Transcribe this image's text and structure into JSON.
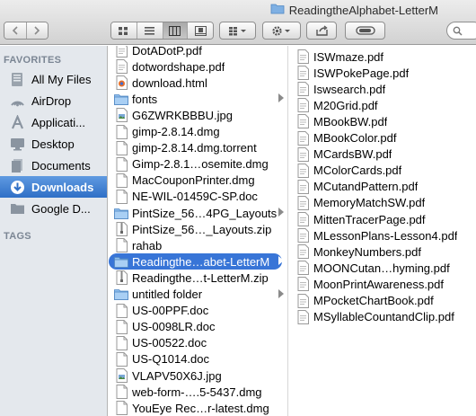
{
  "window": {
    "title": "ReadingtheAlphabet-LetterM"
  },
  "toolbar": {
    "back_icon": "chevron-left-icon",
    "forward_icon": "chevron-right-icon",
    "view_modes": [
      "icon-view-icon",
      "list-view-icon",
      "column-view-icon",
      "cover-flow-icon"
    ],
    "active_view": "column-view-icon",
    "arrange_icon": "arrange-icon",
    "action_icon": "gear-icon",
    "share_icon": "share-icon",
    "tag_icon": "tag-icon"
  },
  "sidebar": {
    "favorites_heading": "FAVORITES",
    "tags_heading": "TAGS",
    "items": [
      {
        "label": "All My Files",
        "icon": "all-files-icon"
      },
      {
        "label": "AirDrop",
        "icon": "airdrop-icon"
      },
      {
        "label": "Applicati...",
        "icon": "applications-icon"
      },
      {
        "label": "Desktop",
        "icon": "desktop-icon"
      },
      {
        "label": "Documents",
        "icon": "documents-icon"
      },
      {
        "label": "Downloads",
        "icon": "downloads-icon",
        "selected": true
      },
      {
        "label": "Google D...",
        "icon": "folder-icon"
      }
    ]
  },
  "column1": [
    {
      "label": "DotADotP.pdf",
      "icon": "pdf-icon"
    },
    {
      "label": "dotwordshape.pdf",
      "icon": "pdf-icon"
    },
    {
      "label": "download.html",
      "icon": "html-icon"
    },
    {
      "label": "fonts",
      "icon": "folder-icon",
      "folder": true
    },
    {
      "label": "G6ZWRKBBBU.jpg",
      "icon": "image-icon"
    },
    {
      "label": "gimp-2.8.14.dmg",
      "icon": "dmg-icon"
    },
    {
      "label": "gimp-2.8.14.dmg.torrent",
      "icon": "file-icon"
    },
    {
      "label": "Gimp-2.8.1…osemite.dmg",
      "icon": "dmg-icon"
    },
    {
      "label": "MacCouponPrinter.dmg",
      "icon": "dmg-icon"
    },
    {
      "label": "NE-WIL-01459C-SP.doc",
      "icon": "doc-icon"
    },
    {
      "label": "PintSize_56…4PG_Layouts",
      "icon": "folder-icon",
      "folder": true
    },
    {
      "label": "PintSize_56…_Layouts.zip",
      "icon": "zip-icon"
    },
    {
      "label": "rahab",
      "icon": "file-icon"
    },
    {
      "label": "Readingthe…abet-LetterM",
      "icon": "folder-icon",
      "folder": true,
      "selected": true
    },
    {
      "label": "Readingthe…t-LetterM.zip",
      "icon": "zip-icon"
    },
    {
      "label": "untitled folder",
      "icon": "folder-icon",
      "folder": true
    },
    {
      "label": "US-00PPF.doc",
      "icon": "doc-icon"
    },
    {
      "label": "US-0098LR.doc",
      "icon": "doc-icon"
    },
    {
      "label": "US-00522.doc",
      "icon": "doc-icon"
    },
    {
      "label": "US-Q1014.doc",
      "icon": "doc-icon"
    },
    {
      "label": "VLAPV50X6J.jpg",
      "icon": "image-icon"
    },
    {
      "label": "web-form-….5-5437.dmg",
      "icon": "dmg-icon"
    },
    {
      "label": "YouEye Rec…r-latest.dmg",
      "icon": "dmg-icon"
    }
  ],
  "column2": [
    {
      "label": "ISWmaze.pdf",
      "icon": "pdf-icon"
    },
    {
      "label": "ISWPokePage.pdf",
      "icon": "pdf-icon"
    },
    {
      "label": "Iswsearch.pdf",
      "icon": "pdf-icon"
    },
    {
      "label": "M20Grid.pdf",
      "icon": "pdf-icon"
    },
    {
      "label": "MBookBW.pdf",
      "icon": "pdf-icon"
    },
    {
      "label": "MBookColor.pdf",
      "icon": "pdf-icon"
    },
    {
      "label": "MCardsBW.pdf",
      "icon": "pdf-icon"
    },
    {
      "label": "MColorCards.pdf",
      "icon": "pdf-icon"
    },
    {
      "label": "MCutandPattern.pdf",
      "icon": "pdf-icon"
    },
    {
      "label": "MemoryMatchSW.pdf",
      "icon": "pdf-icon"
    },
    {
      "label": "MittenTracerPage.pdf",
      "icon": "pdf-icon"
    },
    {
      "label": "MLessonPlans-Lesson4.pdf",
      "icon": "pdf-icon"
    },
    {
      "label": "MonkeyNumbers.pdf",
      "icon": "pdf-icon"
    },
    {
      "label": "MOONCutan…hyming.pdf",
      "icon": "pdf-icon"
    },
    {
      "label": "MoonPrintAwareness.pdf",
      "icon": "pdf-icon"
    },
    {
      "label": "MPocketChartBook.pdf",
      "icon": "pdf-icon"
    },
    {
      "label": "MSyllableCountandClip.pdf",
      "icon": "pdf-icon"
    }
  ]
}
